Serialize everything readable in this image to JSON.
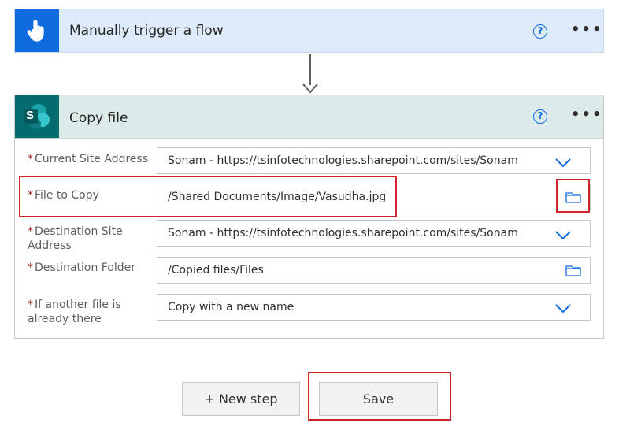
{
  "trigger": {
    "title": "Manually trigger a flow",
    "icon": "touch-hand-icon",
    "help_glyph": "?",
    "menu_glyph": "•••",
    "color": "#0f6cde"
  },
  "action": {
    "title": "Copy file",
    "icon": "sharepoint-icon",
    "icon_letter": "S",
    "help_glyph": "?",
    "menu_glyph": "•••",
    "color": "#036c70"
  },
  "fields": [
    {
      "label_lines": [
        "Current Site Address"
      ],
      "value": "Sonam - https://tsinfotechnologies.sharepoint.com/sites/Sonam",
      "control": "dropdown"
    },
    {
      "label_lines": [
        "File to Copy"
      ],
      "value": "/Shared Documents/Image/Vasudha.jpg",
      "control": "folder-picker"
    },
    {
      "label_lines": [
        "Destination Site",
        "Address"
      ],
      "value": "Sonam - https://tsinfotechnologies.sharepoint.com/sites/Sonam",
      "control": "dropdown"
    },
    {
      "label_lines": [
        "Destination Folder"
      ],
      "value": "/Copied files/Files",
      "control": "folder-picker"
    },
    {
      "label_lines": [
        "If another file is",
        "already there"
      ],
      "value": "Copy with a new name",
      "control": "dropdown"
    }
  ],
  "required_mark": "*",
  "buttons": {
    "new_step": "+ New step",
    "save": "Save"
  },
  "highlight_color": "#d1232a"
}
